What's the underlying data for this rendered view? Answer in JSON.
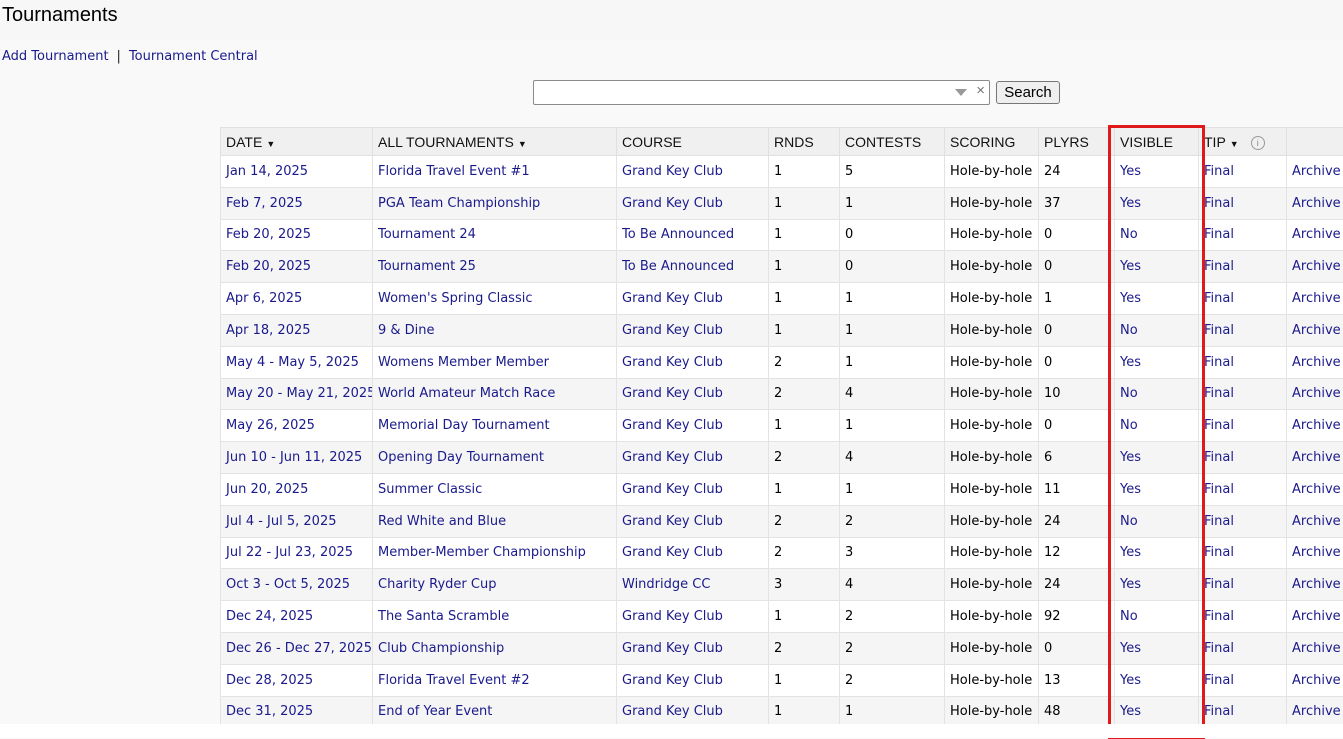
{
  "page": {
    "title": "Tournaments"
  },
  "nav": {
    "add_tournament": "Add Tournament",
    "separator": "|",
    "tournament_central": "Tournament Central"
  },
  "search": {
    "value": "",
    "clear_glyph": "×",
    "button_label": "Search"
  },
  "table": {
    "headers": {
      "date": "DATE",
      "tournament": "ALL TOURNAMENTS",
      "course": "COURSE",
      "rounds": "RNDS",
      "contests": "CONTESTS",
      "scoring": "SCORING",
      "players": "PLYRS",
      "visible": "VISIBLE",
      "tip": "TIP",
      "sort_caret": "▼",
      "info_glyph": "i"
    },
    "rows": [
      {
        "date": "Jan 14, 2025",
        "name": "Florida Travel Event #1",
        "course": "Grand Key Club",
        "rounds": "1",
        "contests": "5",
        "scoring": "Hole-by-hole",
        "players": "24",
        "visible": "Yes",
        "tip": "Final",
        "action": "Archive"
      },
      {
        "date": "Feb 7, 2025",
        "name": "PGA Team Championship",
        "course": "Grand Key Club",
        "rounds": "1",
        "contests": "1",
        "scoring": "Hole-by-hole",
        "players": "37",
        "visible": "Yes",
        "tip": "Final",
        "action": "Archive"
      },
      {
        "date": "Feb 20, 2025",
        "name": "Tournament 24",
        "course": "To Be Announced",
        "rounds": "1",
        "contests": "0",
        "scoring": "Hole-by-hole",
        "players": "0",
        "visible": "No",
        "tip": "Final",
        "action": "Archive"
      },
      {
        "date": "Feb 20, 2025",
        "name": "Tournament 25",
        "course": "To Be Announced",
        "rounds": "1",
        "contests": "0",
        "scoring": "Hole-by-hole",
        "players": "0",
        "visible": "Yes",
        "tip": "Final",
        "action": "Archive"
      },
      {
        "date": "Apr 6, 2025",
        "name": "Women's Spring Classic",
        "course": "Grand Key Club",
        "rounds": "1",
        "contests": "1",
        "scoring": "Hole-by-hole",
        "players": "1",
        "visible": "Yes",
        "tip": "Final",
        "action": "Archive"
      },
      {
        "date": "Apr 18, 2025",
        "name": "9 & Dine",
        "course": "Grand Key Club",
        "rounds": "1",
        "contests": "1",
        "scoring": "Hole-by-hole",
        "players": "0",
        "visible": "No",
        "tip": "Final",
        "action": "Archive"
      },
      {
        "date": "May 4 - May 5, 2025",
        "name": "Womens Member Member",
        "course": "Grand Key Club",
        "rounds": "2",
        "contests": "1",
        "scoring": "Hole-by-hole",
        "players": "0",
        "visible": "Yes",
        "tip": "Final",
        "action": "Archive"
      },
      {
        "date": "May 20 - May 21, 2025",
        "name": "World Amateur Match Race",
        "course": "Grand Key Club",
        "rounds": "2",
        "contests": "4",
        "scoring": "Hole-by-hole",
        "players": "10",
        "visible": "No",
        "tip": "Final",
        "action": "Archive"
      },
      {
        "date": "May 26, 2025",
        "name": "Memorial Day Tournament",
        "course": "Grand Key Club",
        "rounds": "1",
        "contests": "1",
        "scoring": "Hole-by-hole",
        "players": "0",
        "visible": "No",
        "tip": "Final",
        "action": "Archive"
      },
      {
        "date": "Jun 10 - Jun 11, 2025",
        "name": "Opening Day Tournament",
        "course": "Grand Key Club",
        "rounds": "2",
        "contests": "4",
        "scoring": "Hole-by-hole",
        "players": "6",
        "visible": "Yes",
        "tip": "Final",
        "action": "Archive"
      },
      {
        "date": "Jun 20, 2025",
        "name": "Summer Classic",
        "course": "Grand Key Club",
        "rounds": "1",
        "contests": "1",
        "scoring": "Hole-by-hole",
        "players": "11",
        "visible": "Yes",
        "tip": "Final",
        "action": "Archive"
      },
      {
        "date": "Jul 4 - Jul 5, 2025",
        "name": "Red White and Blue",
        "course": "Grand Key Club",
        "rounds": "2",
        "contests": "2",
        "scoring": "Hole-by-hole",
        "players": "24",
        "visible": "No",
        "tip": "Final",
        "action": "Archive"
      },
      {
        "date": "Jul 22 - Jul 23, 2025",
        "name": "Member-Member Championship",
        "course": "Grand Key Club",
        "rounds": "2",
        "contests": "3",
        "scoring": "Hole-by-hole",
        "players": "12",
        "visible": "Yes",
        "tip": "Final",
        "action": "Archive"
      },
      {
        "date": "Oct 3 - Oct 5, 2025",
        "name": "Charity Ryder Cup",
        "course": "Windridge CC",
        "rounds": "3",
        "contests": "4",
        "scoring": "Hole-by-hole",
        "players": "24",
        "visible": "Yes",
        "tip": "Final",
        "action": "Archive"
      },
      {
        "date": "Dec 24, 2025",
        "name": "The Santa Scramble",
        "course": "Grand Key Club",
        "rounds": "1",
        "contests": "2",
        "scoring": "Hole-by-hole",
        "players": "92",
        "visible": "No",
        "tip": "Final",
        "action": "Archive"
      },
      {
        "date": "Dec 26 - Dec 27, 2025",
        "name": "Club Championship",
        "course": "Grand Key Club",
        "rounds": "2",
        "contests": "2",
        "scoring": "Hole-by-hole",
        "players": "0",
        "visible": "Yes",
        "tip": "Final",
        "action": "Archive"
      },
      {
        "date": "Dec 28, 2025",
        "name": "Florida Travel Event #2",
        "course": "Grand Key Club",
        "rounds": "1",
        "contests": "2",
        "scoring": "Hole-by-hole",
        "players": "13",
        "visible": "Yes",
        "tip": "Final",
        "action": "Archive"
      },
      {
        "date": "Dec 31, 2025",
        "name": "End of Year Event",
        "course": "Grand Key Club",
        "rounds": "1",
        "contests": "1",
        "scoring": "Hole-by-hole",
        "players": "48",
        "visible": "Yes",
        "tip": "Final",
        "action": "Archive"
      }
    ]
  },
  "colors": {
    "link": "#1a1a8c",
    "highlight": "#e01a1a"
  }
}
